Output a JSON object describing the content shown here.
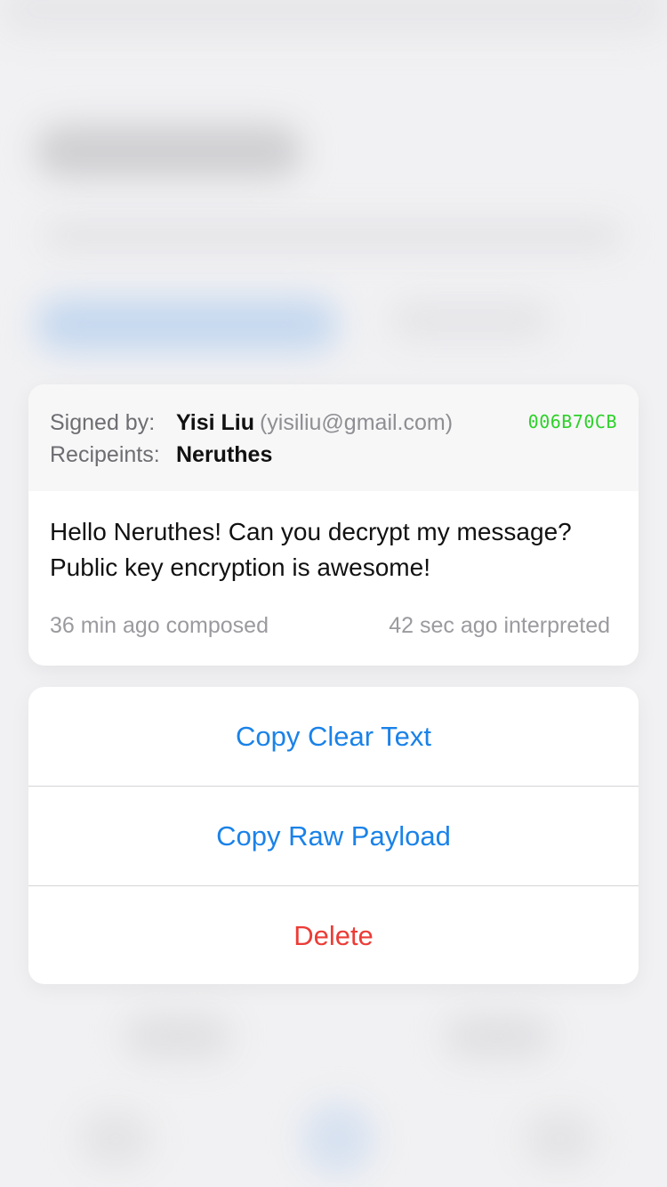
{
  "message": {
    "signed_by_label": "Signed by:",
    "signer_name": "Yisi Liu",
    "signer_email": "(yisiliu@gmail.com)",
    "key_id": "006B70CB",
    "recipients_label": "Recipeints:",
    "recipient_name": "Neruthes",
    "body": "Hello Neruthes! Can you decrypt my message? Public key encryption is awesome!",
    "composed": "36 min ago composed",
    "interpreted": "42 sec ago interpreted"
  },
  "actions": {
    "copy_clear_text": "Copy Clear Text",
    "copy_raw_payload": "Copy Raw Payload",
    "delete": "Delete"
  },
  "colors": {
    "accent": "#1a82e8",
    "destructive": "#ec3c36",
    "key_id": "#2ed12a"
  }
}
